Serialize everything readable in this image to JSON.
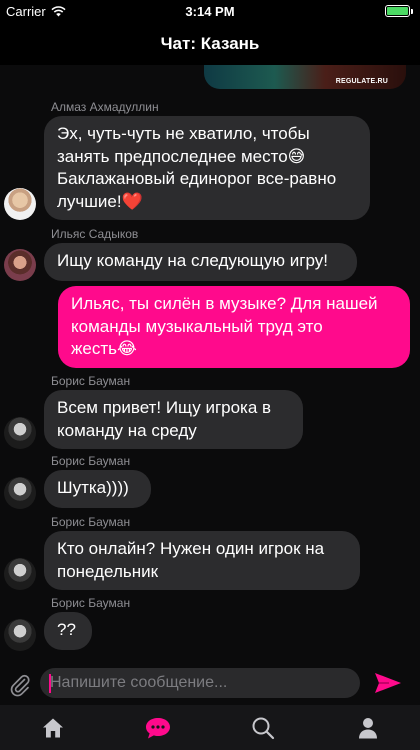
{
  "status_bar": {
    "carrier": "Carrier",
    "time": "3:14 PM",
    "battery_level": 1.0
  },
  "nav": {
    "title": "Чат: Казань"
  },
  "image_preview": {
    "watermark": "REGULATE.RU"
  },
  "messages": [
    {
      "sender": "Алмаз Ахмадуллин",
      "text": "Эх, чуть-чуть не хватило, чтобы\nзанять предпоследнее место😅\nБаклажановый единорог все-равно\nлучшие!❤️"
    },
    {
      "sender": "Ильяс Садыков",
      "text": "Ищу команду на следующую игру!"
    },
    {
      "text": "Ильяс, ты силён в музыке? Для нашей\nкоманды музыкальный труд это\nжесть😂"
    },
    {
      "sender": "Борис Бауман",
      "text": "Всем привет! Ищу игрока в\nкоманду на среду"
    },
    {
      "sender": "Борис Бауман",
      "text": "Шутка))))"
    },
    {
      "sender": "Борис Бауман",
      "text": "Кто онлайн? Нужен один игрок на\nпонедельник"
    },
    {
      "sender": "Борис Бауман",
      "text": "??"
    }
  ],
  "composer": {
    "placeholder": "Напишите сообщение...",
    "value": ""
  },
  "tabs": [
    {
      "icon": "home-icon"
    },
    {
      "icon": "chat-icon",
      "active": true
    },
    {
      "icon": "search-icon"
    },
    {
      "icon": "profile-icon"
    }
  ],
  "colors": {
    "accent": "#ff0a8c",
    "incoming_bubble": "#2c2c2e",
    "background": "#000000",
    "battery": "#4cd964"
  }
}
